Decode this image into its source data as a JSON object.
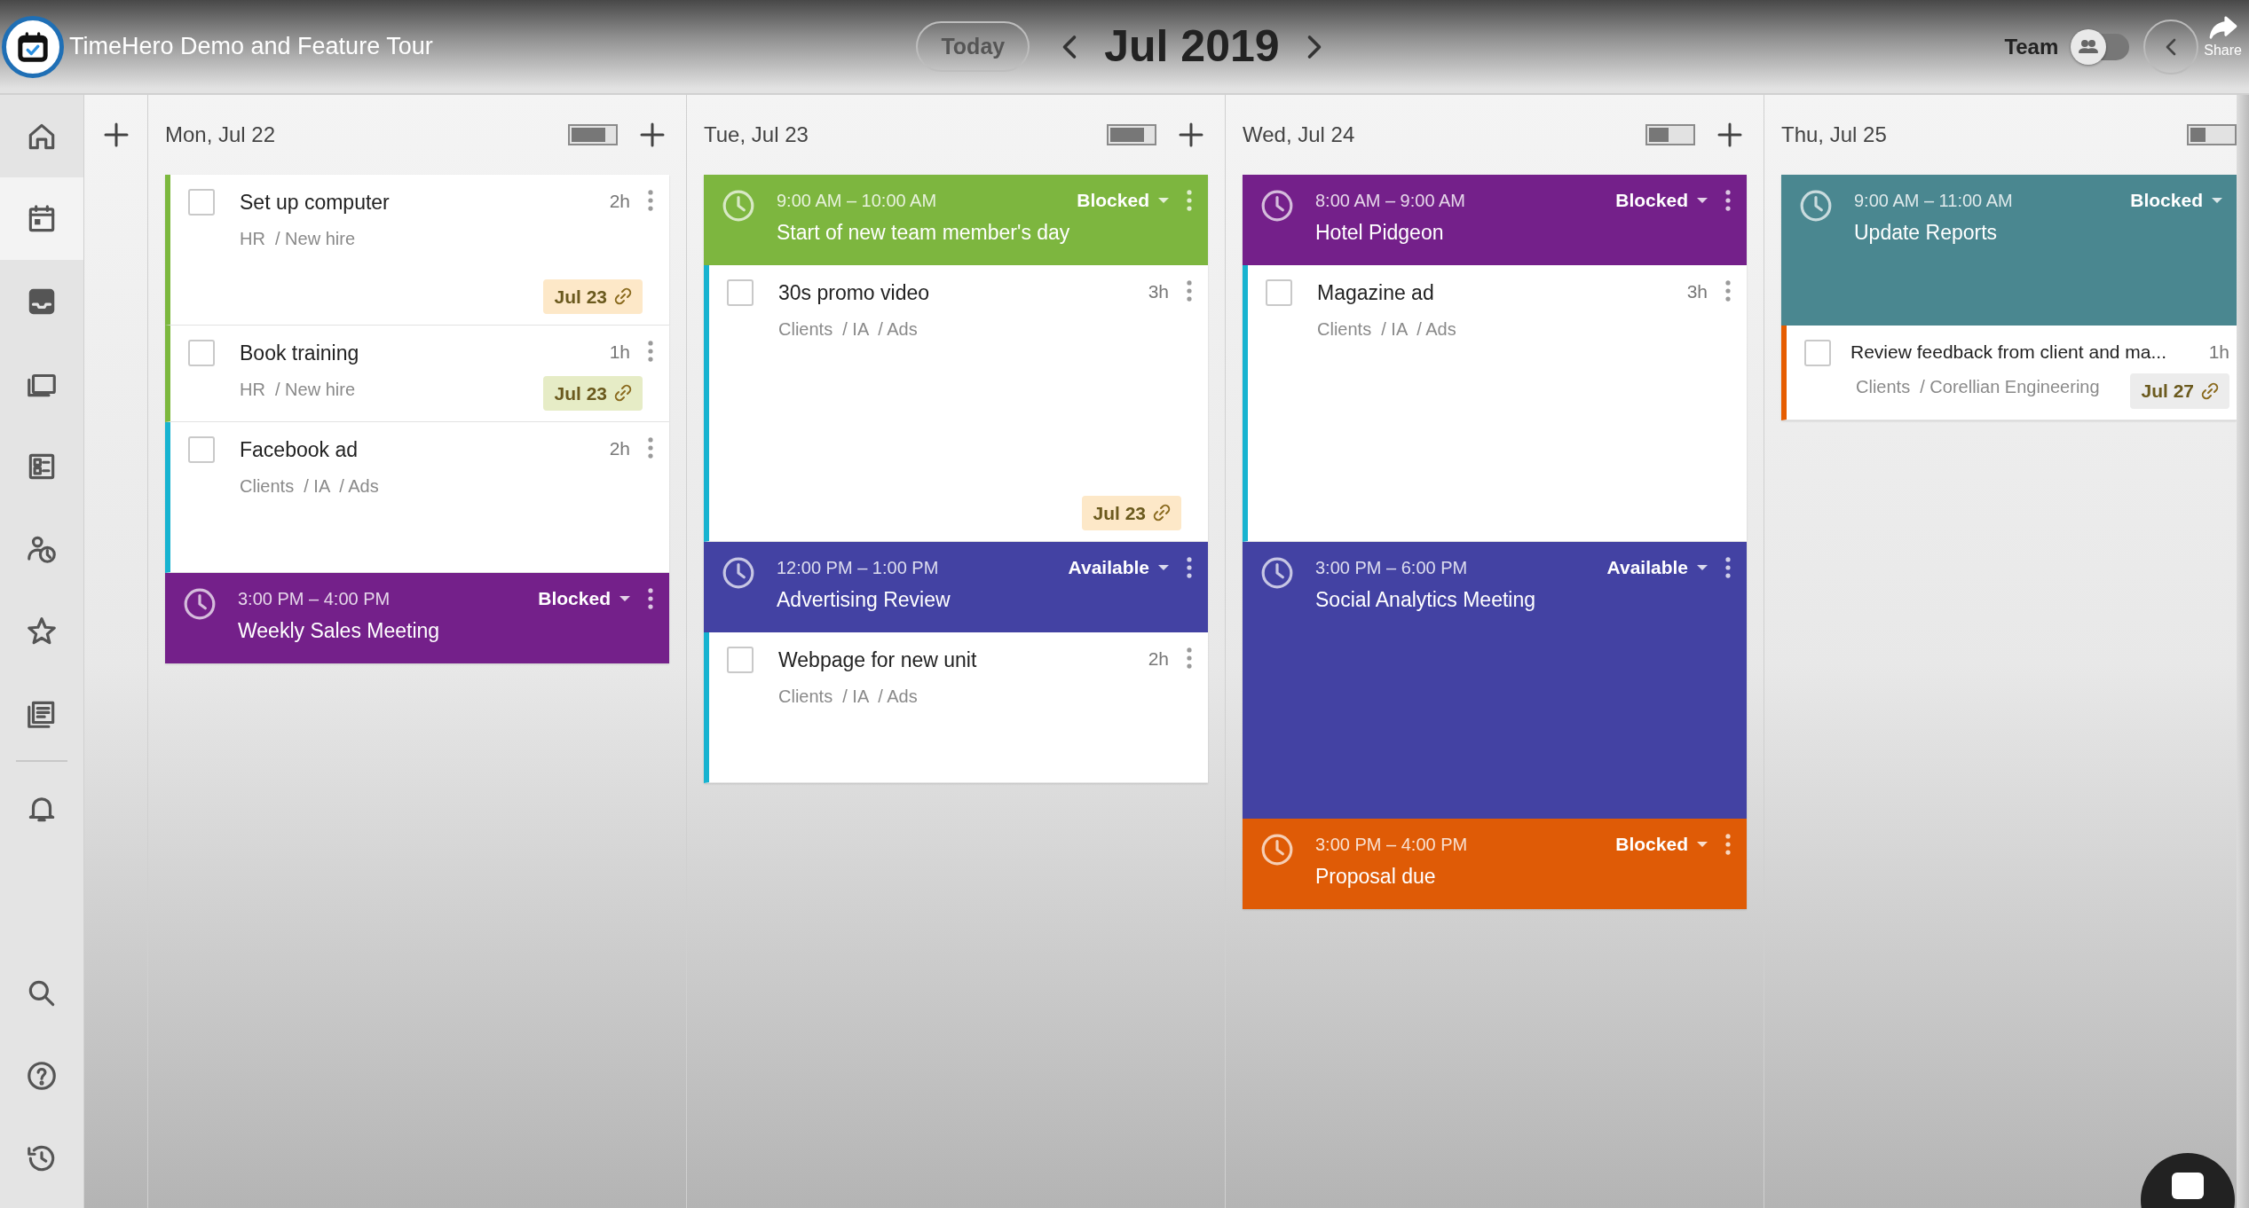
{
  "video": {
    "title": "TimeHero Demo and Feature Tour",
    "share": "Share"
  },
  "toolbar": {
    "today": "Today",
    "month": "Jul 2019",
    "team_label": "Team",
    "team_toggle": {
      "on": false
    }
  },
  "sidebar": {
    "items": [
      {
        "kind": "home",
        "selected": false
      },
      {
        "kind": "calendar",
        "selected": true
      },
      {
        "kind": "inbox",
        "selected": false
      },
      {
        "kind": "projects",
        "selected": false
      },
      {
        "kind": "checklist",
        "selected": false
      },
      {
        "kind": "person-clock",
        "selected": false
      },
      {
        "kind": "star",
        "selected": false
      },
      {
        "kind": "list",
        "selected": false
      },
      {
        "kind": "bell",
        "selected": false
      }
    ],
    "bottom_items": [
      {
        "kind": "search",
        "selected": false
      },
      {
        "kind": "help",
        "selected": false
      },
      {
        "kind": "history",
        "selected": false
      }
    ]
  },
  "columns": [
    {
      "date": "Mon, Jul 22",
      "capacity": {
        "level": 0.8
      },
      "has_add": true,
      "items": [
        {
          "kind": "task",
          "title": "Set up computer",
          "duration": "2h",
          "path": "HR  / New hire",
          "color": "#7cb83e",
          "long": true,
          "tall": false,
          "checked": false,
          "badge": {
            "text": "Jul 23",
            "color": "#fde8c8"
          }
        },
        {
          "kind": "task",
          "title": "Book training",
          "duration": "1h",
          "path": "HR  / New hire",
          "color": "#7cb83e",
          "long": false,
          "tall": false,
          "checked": false,
          "badge": {
            "text": "Jul 23",
            "color": "#e6ecc6"
          }
        },
        {
          "kind": "task",
          "title": "Facebook ad",
          "duration": "2h",
          "path": "Clients  / IA  / Ads",
          "color": "#17b3d0",
          "long": true,
          "tall": false,
          "checked": false
        },
        {
          "kind": "event",
          "time": "3:00 PM – 4:00 PM",
          "title": "Weekly Sales Meeting",
          "status": "Blocked",
          "color": "#74208a",
          "long": false,
          "tall": false
        }
      ]
    },
    {
      "date": "Tue, Jul 23",
      "capacity": {
        "level": 0.8
      },
      "has_add": true,
      "items": [
        {
          "kind": "event",
          "time": "9:00 AM – 10:00 AM",
          "title": "Start of new team member's day",
          "status": "Blocked",
          "color": "#7db63f",
          "long": false,
          "tall": false
        },
        {
          "kind": "task",
          "title": "30s promo video",
          "duration": "3h",
          "path": "Clients  / IA  / Ads",
          "color": "#17b3d0",
          "long": false,
          "tall": true,
          "checked": false,
          "badge": {
            "text": "Jul 23",
            "color": "#fde8c8"
          }
        },
        {
          "kind": "event",
          "time": "12:00 PM – 1:00 PM",
          "title": "Advertising Review",
          "status": "Available",
          "color": "#4342a3",
          "long": false,
          "tall": false
        },
        {
          "kind": "task",
          "title": "Webpage for new unit",
          "duration": "2h",
          "path": "Clients  / IA  / Ads",
          "color": "#17b3d0",
          "long": true,
          "tall": false,
          "checked": false
        }
      ]
    },
    {
      "date": "Wed, Jul 24",
      "capacity": {
        "level": 0.45
      },
      "has_add": true,
      "items": [
        {
          "kind": "event",
          "time": "8:00 AM – 9:00 AM",
          "title": "Hotel Pidgeon",
          "status": "Blocked",
          "color": "#74208a",
          "long": false,
          "tall": false
        },
        {
          "kind": "task",
          "title": "Magazine ad",
          "duration": "3h",
          "path": "Clients  / IA  / Ads",
          "color": "#17b3d0",
          "long": false,
          "tall": true,
          "checked": false
        },
        {
          "kind": "event",
          "time": "3:00 PM – 6:00 PM",
          "title": "Social Analytics Meeting",
          "status": "Available",
          "color": "#4342a3",
          "long": false,
          "tall": true
        },
        {
          "kind": "event",
          "time": "3:00 PM – 4:00 PM",
          "title": "Proposal due",
          "status": "Blocked",
          "color": "#df5b06",
          "long": false,
          "tall": false
        }
      ]
    },
    {
      "date": "Thu, Jul 25",
      "capacity": {
        "level": 0.35
      },
      "has_add": false,
      "items": [
        {
          "kind": "event",
          "time": "9:00 AM – 11:00 AM",
          "title": "Update Reports",
          "status": "Blocked",
          "color": "#4a8790",
          "long": true,
          "tall": false
        },
        {
          "kind": "task",
          "title": "Review feedback from client and ma...",
          "duration": "1h",
          "path": "Clients  / Corellian Engineering",
          "color": "#e65c00",
          "long": false,
          "tall": false,
          "checked": false,
          "badge": {
            "text": "Jul 27",
            "color": "#ececec"
          }
        }
      ]
    }
  ]
}
